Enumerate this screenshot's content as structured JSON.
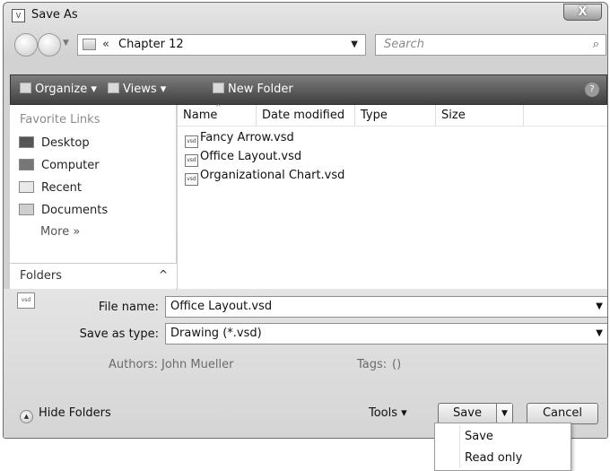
{
  "window": {
    "title": "Save As",
    "close_glyph": "X"
  },
  "address": {
    "chevron": "«",
    "path": "Chapter 12",
    "search_placeholder": "Search"
  },
  "toolbar": {
    "organize": "Organize ▾",
    "views": "Views ▾",
    "new_folder": "New Folder",
    "help": "?"
  },
  "sidebar": {
    "header": "Favorite Links",
    "items": [
      {
        "label": "Desktop",
        "icon": "desktop-icon"
      },
      {
        "label": "Computer",
        "icon": "computer-icon"
      },
      {
        "label": "Recent",
        "icon": "recent-icon"
      },
      {
        "label": "Documents",
        "icon": "documents-icon"
      }
    ],
    "more": "More »",
    "folders": "Folders",
    "folders_caret": "^"
  },
  "filelist": {
    "columns": [
      "Name",
      "Date modified",
      "Type",
      "Size"
    ],
    "files": [
      "Fancy Arrow.vsd",
      "Office Layout.vsd",
      "Organizational Chart.vsd"
    ]
  },
  "form": {
    "file_name_label": "File name:",
    "file_name_value": "Office Layout.vsd",
    "save_type_label": "Save as type:",
    "save_type_value": "Drawing (*.vsd)",
    "authors_label": "Authors:",
    "authors_value": "John Mueller",
    "tags_label": "Tags:",
    "tags_value": "()"
  },
  "footer": {
    "hide_folders": "Hide Folders",
    "tools": "Tools ▾",
    "save": "Save",
    "cancel": "Cancel"
  },
  "save_menu": {
    "items": [
      "Save",
      "Read only"
    ]
  }
}
